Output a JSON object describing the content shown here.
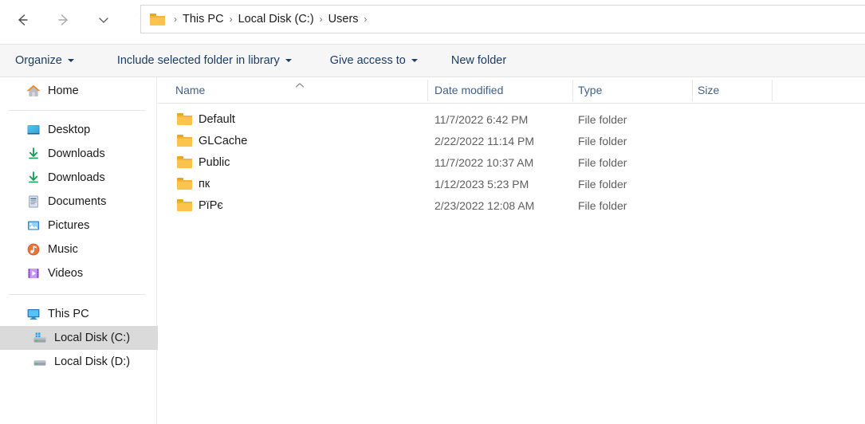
{
  "window": {
    "app": "File Explorer"
  },
  "nav": {
    "back_tooltip": "Back",
    "forward_tooltip": "Forward",
    "recent_tooltip": "Recent locations",
    "up_tooltip": "Up",
    "back_icon": "arrow-left-icon",
    "forward_icon": "arrow-right-icon",
    "recent_icon": "chevron-down-icon",
    "up_icon": "arrow-up-icon"
  },
  "address": {
    "folder_icon": "folder-icon",
    "separator": "›",
    "crumbs": [
      "This PC",
      "Local Disk (C:)",
      "Users"
    ]
  },
  "toolbar": {
    "organize": "Organize",
    "include": "Include selected folder in library",
    "give_access": "Give access to",
    "new_folder": "New folder"
  },
  "sidebar": {
    "home": {
      "label": "Home",
      "icon": "home-icon"
    },
    "quick_access": [
      {
        "label": "Desktop",
        "icon": "desktop-icon",
        "pinned": "pin-icon"
      },
      {
        "label": "Downloads",
        "icon": "download-icon",
        "pinned": "pin-icon"
      },
      {
        "label": "Downloads",
        "icon": "download-icon",
        "pinned": "pin-icon"
      },
      {
        "label": "Documents",
        "icon": "documents-icon",
        "pinned": "pin-icon"
      },
      {
        "label": "Pictures",
        "icon": "pictures-icon",
        "pinned": "pin-icon"
      },
      {
        "label": "Music",
        "icon": "music-icon",
        "pinned": "pin-icon"
      },
      {
        "label": "Videos",
        "icon": "videos-icon",
        "pinned": "pin-icon"
      }
    ],
    "this_pc": {
      "label": "This PC",
      "icon": "monitor-icon"
    },
    "drives": [
      {
        "label": "Local Disk (C:)",
        "icon": "system-drive-icon",
        "selected": true
      },
      {
        "label": "Local Disk (D:)",
        "icon": "drive-icon",
        "selected": false
      }
    ]
  },
  "filelist": {
    "columns": {
      "name": "Name",
      "date_modified": "Date modified",
      "type": "Type",
      "size": "Size"
    },
    "sort": {
      "column": "Name",
      "direction": "ascending",
      "icon": "chevron-up-icon"
    },
    "rows": [
      {
        "name": "Default",
        "date_modified": "11/7/2022 6:42 PM",
        "type": "File folder",
        "size": "",
        "icon": "folder-icon"
      },
      {
        "name": "GLCache",
        "date_modified": "2/22/2022 11:14 PM",
        "type": "File folder",
        "size": "",
        "icon": "folder-icon"
      },
      {
        "name": "Public",
        "date_modified": "11/7/2022 10:37 AM",
        "type": "File folder",
        "size": "",
        "icon": "folder-icon"
      },
      {
        "name": "пк",
        "date_modified": "1/12/2023 5:23 PM",
        "type": "File folder",
        "size": "",
        "icon": "folder-icon"
      },
      {
        "name": "PïPє",
        "date_modified": "2/23/2022 12:08 AM",
        "type": "File folder",
        "size": "",
        "icon": "folder-icon"
      }
    ]
  },
  "colors": {
    "folder_yellow": "#fcc34d",
    "header_text": "#41618a",
    "toolbar_text": "#1c3c60",
    "selection": "#dadada"
  }
}
